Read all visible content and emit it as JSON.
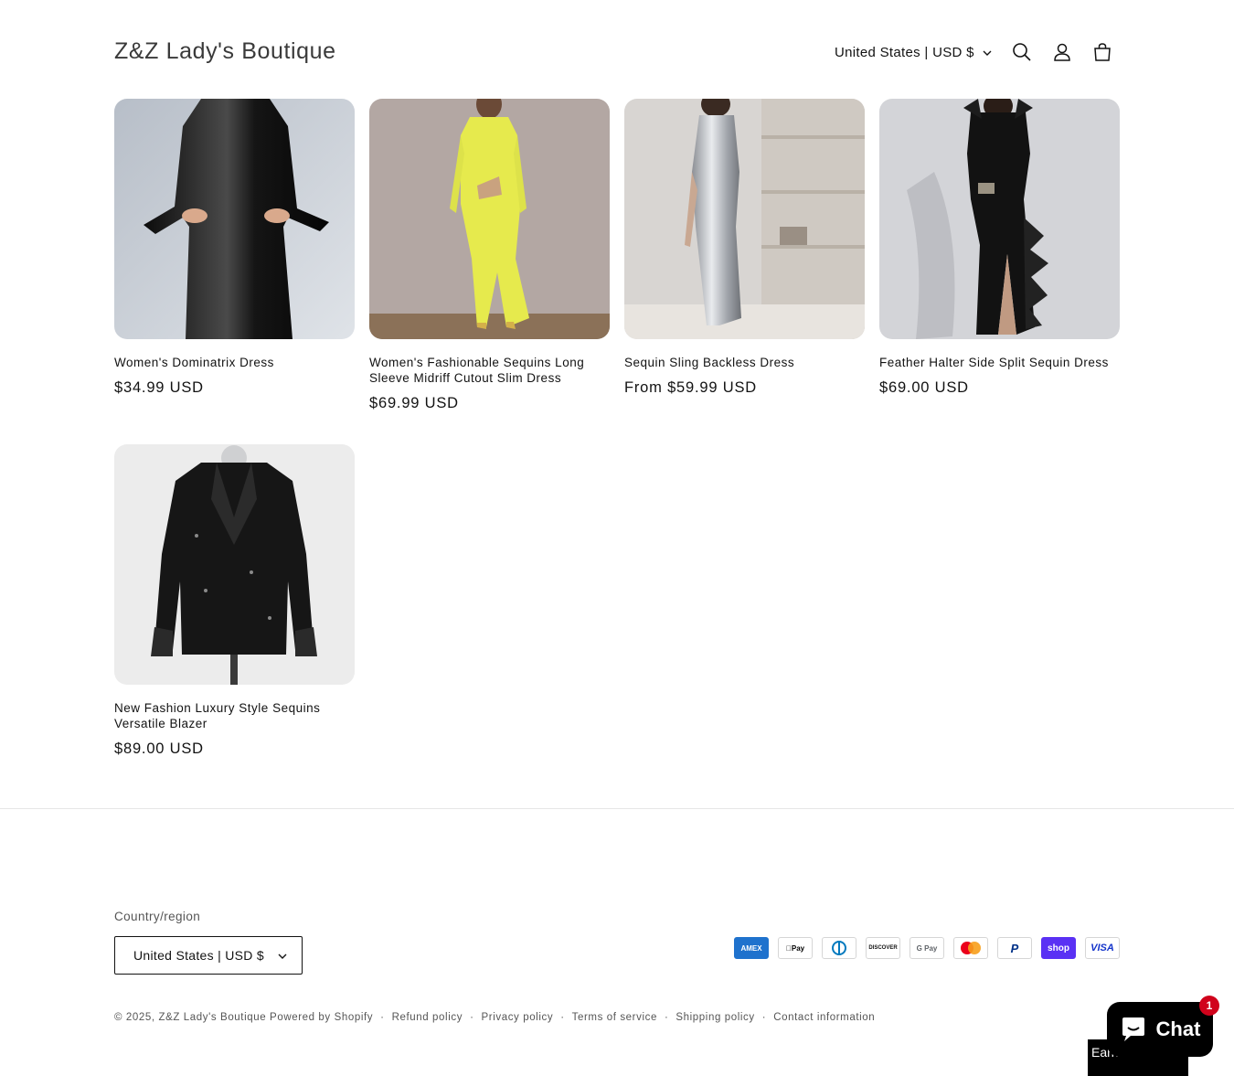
{
  "header": {
    "logo": "Z&Z Lady's Boutique",
    "localization": "United States | USD $"
  },
  "products": [
    {
      "title": "Women's Dominatrix Dress",
      "price": "$34.99 USD"
    },
    {
      "title": "Women's Fashionable Sequins Long Sleeve Midriff Cutout Slim Dress",
      "price": "$69.99 USD"
    },
    {
      "title": "Sequin Sling Backless Dress",
      "price": "From $59.99 USD"
    },
    {
      "title": "Feather Halter Side Split Sequin Dress",
      "price": "$69.00 USD"
    },
    {
      "title": "New Fashion Luxury Style Sequins Versatile Blazer",
      "price": "$89.00 USD"
    }
  ],
  "footer": {
    "country_label": "Country/region",
    "country_value": "United States | USD $",
    "payments": [
      "American Express",
      "Apple Pay",
      "Diners Club",
      "Discover",
      "Google Pay",
      "Mastercard",
      "PayPal",
      "Shop Pay",
      "Visa"
    ],
    "payment_labels": {
      "amex": "AMEX",
      "applepay": "Pay",
      "discover": "DISCOVER",
      "gpay": "G Pay",
      "paypal": "P",
      "shoppay": "shop",
      "visa": "VISA"
    },
    "copyright": "© 2025,",
    "store_link": "Z&Z Lady's Boutique",
    "powered": "Powered by Shopify",
    "links": [
      "Refund policy",
      "Privacy policy",
      "Terms of service",
      "Shipping policy",
      "Contact information"
    ],
    "separator": "·"
  },
  "widgets": {
    "earn_text": "Earn",
    "chat_label": "Chat",
    "chat_badge": "1"
  }
}
